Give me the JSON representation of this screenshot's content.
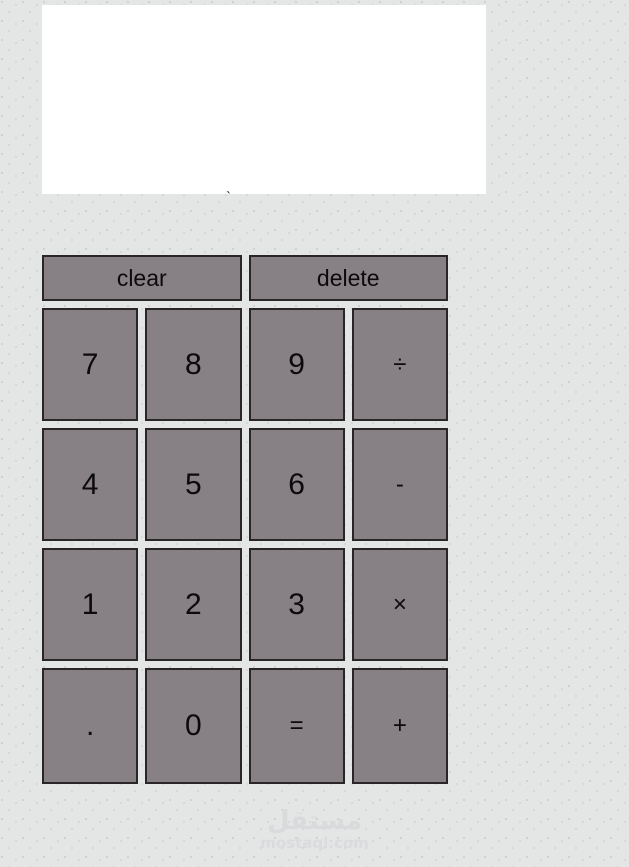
{
  "app": {
    "name": "calculator",
    "background_color": "#e4e6e6",
    "button_color": "#878084",
    "button_border_color": "#2a2628",
    "display_color": "#ffffff",
    "text_color": "#0c0a0b"
  },
  "display": {
    "value": "",
    "placeholder": ""
  },
  "stray_mark": {
    "char": "`"
  },
  "keypad": {
    "rows": [
      {
        "name": "row-actions",
        "keys": [
          {
            "label": "clear",
            "name": "clear-button",
            "kind": "wide"
          },
          {
            "label": "delete",
            "name": "delete-button",
            "kind": "wide"
          }
        ]
      },
      {
        "name": "row-789",
        "keys": [
          {
            "label": "7",
            "name": "digit-7-button",
            "kind": "pad"
          },
          {
            "label": "8",
            "name": "digit-8-button",
            "kind": "pad"
          },
          {
            "label": "9",
            "name": "digit-9-button",
            "kind": "pad"
          },
          {
            "label": "÷",
            "name": "divide-button",
            "kind": "pad op-small"
          }
        ]
      },
      {
        "name": "row-456",
        "keys": [
          {
            "label": "4",
            "name": "digit-4-button",
            "kind": "pad"
          },
          {
            "label": "5",
            "name": "digit-5-button",
            "kind": "pad"
          },
          {
            "label": "6",
            "name": "digit-6-button",
            "kind": "pad"
          },
          {
            "label": "-",
            "name": "minus-button",
            "kind": "pad op-small"
          }
        ]
      },
      {
        "name": "row-123",
        "keys": [
          {
            "label": "1",
            "name": "digit-1-button",
            "kind": "pad"
          },
          {
            "label": "2",
            "name": "digit-2-button",
            "kind": "pad"
          },
          {
            "label": "3",
            "name": "digit-3-button",
            "kind": "pad"
          },
          {
            "label": "×",
            "name": "multiply-button",
            "kind": "pad op-small"
          }
        ]
      },
      {
        "name": "row-last",
        "keys": [
          {
            "label": ".",
            "name": "decimal-point-button",
            "kind": "pad dot"
          },
          {
            "label": "0",
            "name": "digit-0-button",
            "kind": "pad"
          },
          {
            "label": "=",
            "name": "equals-button",
            "kind": "pad op-small"
          },
          {
            "label": "+",
            "name": "plus-button",
            "kind": "pad op-small"
          }
        ]
      }
    ]
  },
  "watermark": {
    "arabic": "مستقل",
    "domain": "mostaql.com"
  }
}
